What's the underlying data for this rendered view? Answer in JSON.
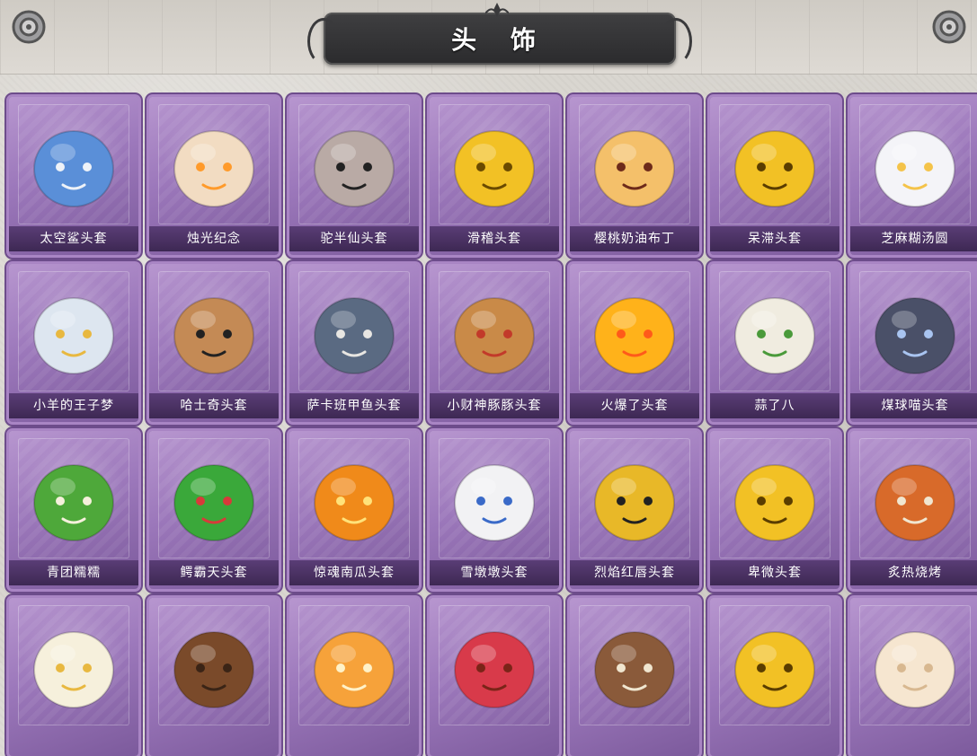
{
  "title": "头 饰",
  "colors": {
    "card": "#9c78bb",
    "card_border": "#6d4c8b",
    "label_bg": "#4a3262",
    "banner": "#333335"
  },
  "items": [
    {
      "name": "太空鲨头套",
      "icon": "shark-head-icon"
    },
    {
      "name": "烛光纪念",
      "icon": "candle-head-icon"
    },
    {
      "name": "驼半仙头套",
      "icon": "alpaca-sunglasses-icon"
    },
    {
      "name": "滑稽头套",
      "icon": "smirk-face-icon"
    },
    {
      "name": "樱桃奶油布丁",
      "icon": "pudding-icon"
    },
    {
      "name": "呆滞头套",
      "icon": "blank-stare-face-icon"
    },
    {
      "name": "芝麻糊汤圆",
      "icon": "dumpling-icon"
    },
    {
      "name": "小羊的王子梦",
      "icon": "crowned-sheep-icon"
    },
    {
      "name": "哈士奇头套",
      "icon": "husky-sunglasses-icon"
    },
    {
      "name": "萨卡班甲鱼头套",
      "icon": "fish-head-icon"
    },
    {
      "name": "小财神豚豚头套",
      "icon": "capybara-icon"
    },
    {
      "name": "火爆了头套",
      "icon": "fire-spirit-icon"
    },
    {
      "name": "蒜了八",
      "icon": "garlic-icon"
    },
    {
      "name": "煤球喵头套",
      "icon": "black-cat-icon"
    },
    {
      "name": "青团糯糯",
      "icon": "green-dumpling-icon"
    },
    {
      "name": "鳄霸天头套",
      "icon": "crocodile-icon"
    },
    {
      "name": "惊魂南瓜头套",
      "icon": "pumpkin-icon"
    },
    {
      "name": "雪墩墩头套",
      "icon": "snowman-reindeer-icon"
    },
    {
      "name": "烈焰红唇头套",
      "icon": "yellow-mouse-sunglasses-icon"
    },
    {
      "name": "卑微头套",
      "icon": "humble-face-icon"
    },
    {
      "name": "炙热烧烤",
      "icon": "meat-bone-icon"
    },
    {
      "name": "",
      "icon": "crowned-egg-icon"
    },
    {
      "name": "",
      "icon": "horse-head-icon"
    },
    {
      "name": "",
      "icon": "orange-slice-icon"
    },
    {
      "name": "",
      "icon": "red-octopus-icon"
    },
    {
      "name": "",
      "icon": "dog-head-icon"
    },
    {
      "name": "",
      "icon": "yellow-face-icon"
    },
    {
      "name": "",
      "icon": "cream-sheep-icon"
    }
  ]
}
